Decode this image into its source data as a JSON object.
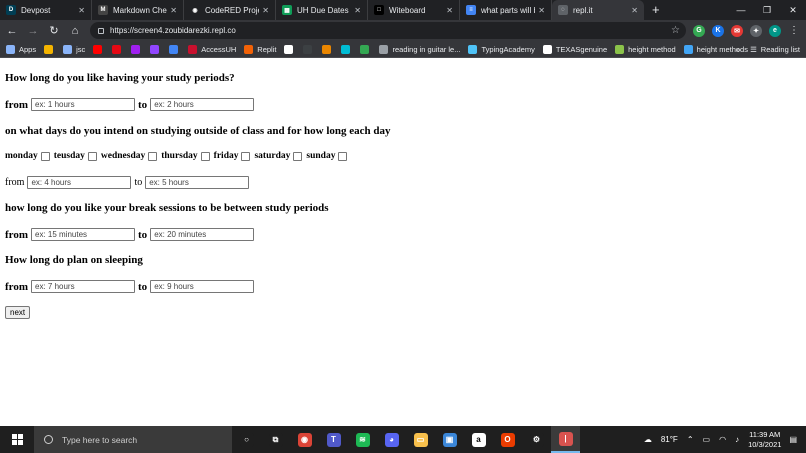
{
  "browser": {
    "tabs": [
      {
        "title": "Devpost",
        "icon": "devpost-icon",
        "color": "#003e54",
        "glyph": "D"
      },
      {
        "title": "Markdown Cheat",
        "icon": "markdown-icon",
        "color": "#444444",
        "glyph": "M"
      },
      {
        "title": "CodeRED Project",
        "icon": "github-icon",
        "color": "#202124",
        "glyph": "◉"
      },
      {
        "title": "UH Due Dates - G",
        "icon": "sheets-icon",
        "color": "#0f9d58",
        "glyph": "▦"
      },
      {
        "title": "Witeboard",
        "icon": "witeboard-icon",
        "color": "#000000",
        "glyph": "□"
      },
      {
        "title": "what parts will be",
        "icon": "docs-icon",
        "color": "#4285f4",
        "glyph": "≡"
      },
      {
        "title": "repl.it",
        "icon": "globe-icon",
        "color": "#5f6368",
        "glyph": "◌"
      }
    ],
    "active_tab_index": 6,
    "url": "https://screen4.zoubidarezki.repl.co",
    "bookmarks": [
      {
        "label": "Apps",
        "icon": "apps-grid-icon",
        "color": "#8ab4f8"
      },
      {
        "label": "",
        "icon": "bookmark-orange-icon",
        "color": "#f4b400"
      },
      {
        "label": "jsc",
        "icon": "bookmark-jsc-icon",
        "color": "#8ab4f8"
      },
      {
        "label": "",
        "icon": "youtube-icon",
        "color": "#ff0000"
      },
      {
        "label": "",
        "icon": "netflix-icon",
        "color": "#e50914"
      },
      {
        "label": "",
        "icon": "bookmark-m-icon",
        "color": "#a020f0"
      },
      {
        "label": "",
        "icon": "bookmark-twitch-icon",
        "color": "#9146ff"
      },
      {
        "label": "",
        "icon": "bookmark-calendar-icon",
        "color": "#4285f4"
      },
      {
        "label": "AccessUH",
        "icon": "accessuh-icon",
        "color": "#c8102e"
      },
      {
        "label": "Replit",
        "icon": "replit-icon",
        "color": "#f26207"
      },
      {
        "label": "",
        "icon": "x-icon",
        "color": "#ffffff"
      },
      {
        "label": "",
        "icon": "bookmark-dark-icon",
        "color": "#3c4043"
      },
      {
        "label": "",
        "icon": "bookmark-orange2-icon",
        "color": "#ea8600"
      },
      {
        "label": "",
        "icon": "bookmark-cyan-icon",
        "color": "#00bcd4"
      },
      {
        "label": "",
        "icon": "bookmark-green-icon",
        "color": "#34a853"
      },
      {
        "label": "reading in guitar le...",
        "icon": "guitar-icon",
        "color": "#9aa0a6"
      },
      {
        "label": "TypingAcademy",
        "icon": "typing-icon",
        "color": "#4fc3f7"
      },
      {
        "label": "TEXASgenuine",
        "icon": "texas-icon",
        "color": "#ffffff"
      },
      {
        "label": "height method",
        "icon": "height-icon",
        "color": "#8bc34a"
      },
      {
        "label": "height methods",
        "icon": "height2-icon",
        "color": "#42a5f5"
      }
    ],
    "reading_list": "Reading list",
    "overflow": "»"
  },
  "form": {
    "q1": "How long do you like having your study periods?",
    "q1_from_label": "from",
    "q1_from_placeholder": "ex: 1 hours",
    "q1_to_label": "to",
    "q1_to_placeholder": "ex: 2 hours",
    "q2": "on what days do you intend on studying outside of class and for how long each day",
    "days": [
      "monday",
      "teusday",
      "wednesday",
      "thursday",
      "friday",
      "saturday",
      "sunday"
    ],
    "q2_from_label": "from",
    "q2_from_placeholder": "ex: 4 hours",
    "q2_to_label": "to",
    "q2_to_placeholder": "ex: 5 hours",
    "q3": "how long do you like your break sessions to be between study periods",
    "q3_from_label": "from",
    "q3_from_placeholder": "ex: 15 minutes",
    "q3_to_label": "to",
    "q3_to_placeholder": "ex: 20 minutes",
    "q4": "How long do plan on sleeping",
    "q4_from_label": "from",
    "q4_from_placeholder": "ex: 7 hours",
    "q4_to_label": "to",
    "q4_to_placeholder": "ex: 9 hours",
    "next_label": "next"
  },
  "taskbar": {
    "search_placeholder": "Type here to search",
    "apps": [
      {
        "icon": "cortana-icon",
        "color": "#1f1f1f",
        "glyph": "○"
      },
      {
        "icon": "task-view-icon",
        "color": "#1f1f1f",
        "glyph": "⧉"
      },
      {
        "icon": "chrome-icon",
        "color": "#db4437",
        "glyph": "◉"
      },
      {
        "icon": "teams-icon",
        "color": "#5059c9",
        "glyph": "T"
      },
      {
        "icon": "spotify-icon",
        "color": "#1db954",
        "glyph": "≋"
      },
      {
        "icon": "discord-icon",
        "color": "#5865f2",
        "glyph": "◕"
      },
      {
        "icon": "file-explorer-icon",
        "color": "#f8c04c",
        "glyph": "▭"
      },
      {
        "icon": "store-icon",
        "color": "#3a86d8",
        "glyph": "▣"
      },
      {
        "icon": "amazon-icon",
        "color": "#ffffff",
        "glyph": "a"
      },
      {
        "icon": "office-icon",
        "color": "#eb3c00",
        "glyph": "O"
      },
      {
        "icon": "settings-icon",
        "color": "#1f1f1f",
        "glyph": "⚙"
      },
      {
        "icon": "app-red-icon",
        "color": "#d9534f",
        "glyph": "|"
      }
    ],
    "weather": "81°F",
    "time": "11:39 AM",
    "date": "10/3/2021"
  }
}
